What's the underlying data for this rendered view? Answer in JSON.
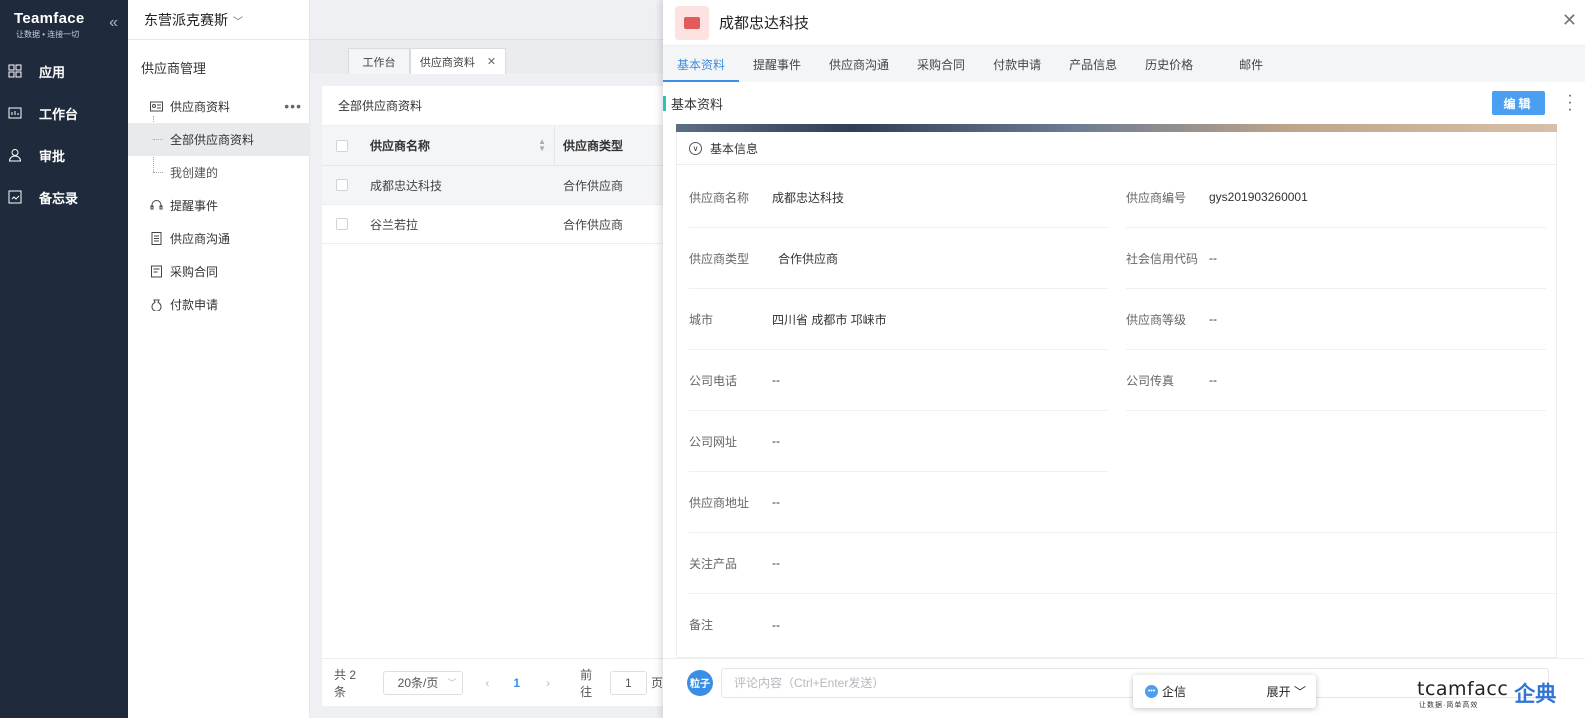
{
  "app": {
    "brand": "Teamface",
    "tagline": "让数据 • 连接一切",
    "nav": [
      {
        "label": "应用",
        "icon": "grid-icon"
      },
      {
        "label": "工作台",
        "icon": "dashboard-icon"
      },
      {
        "label": "审批",
        "icon": "user-approval-icon"
      },
      {
        "label": "备忘录",
        "icon": "memo-icon"
      }
    ]
  },
  "module": {
    "company": "东营派克赛斯",
    "title": "供应商管理",
    "menu": {
      "profile": "供应商资料",
      "all": "全部供应商资料",
      "mine": "我创建的",
      "reminder": "提醒事件",
      "communication": "供应商沟通",
      "contract": "采购合同",
      "payment": "付款申请"
    }
  },
  "tabs": {
    "workbench": "工作台",
    "supplier": "供应商资料"
  },
  "list": {
    "title": "全部供应商资料",
    "columns": [
      "供应商名称",
      "供应商类型"
    ],
    "rows": [
      {
        "name": "成都忠达科技",
        "type": "合作供应商"
      },
      {
        "name": "谷兰若拉",
        "type": "合作供应商"
      }
    ],
    "pager": {
      "total": "共 2 条",
      "size": "20条/页",
      "current": "1",
      "goto_label": "前往",
      "goto_value": "1",
      "page_suffix": "页"
    }
  },
  "detail": {
    "title": "成都忠达科技",
    "tabs": [
      "基本资料",
      "提醒事件",
      "供应商沟通",
      "采购合同",
      "付款申请",
      "产品信息",
      "历史价格",
      "邮件"
    ],
    "section": "基本资料",
    "edit": "编辑",
    "group": "基本信息",
    "fields_left": [
      {
        "label": "供应商名称",
        "value": "成都忠达科技"
      },
      {
        "label": "供应商类型",
        "value": "合作供应商"
      },
      {
        "label": "城市",
        "value": "四川省 成都市 邛崃市"
      },
      {
        "label": "公司电话",
        "value": "--"
      },
      {
        "label": "公司网址",
        "value": "--"
      },
      {
        "label": "供应商地址",
        "value": "--"
      },
      {
        "label": "关注产品",
        "value": "--"
      },
      {
        "label": "备注",
        "value": "--"
      }
    ],
    "fields_right": [
      {
        "label": "供应商编号",
        "value": "gys201903260001"
      },
      {
        "label": "社会信用代码",
        "value": "--"
      },
      {
        "label": "供应商等级",
        "value": "--"
      },
      {
        "label": "公司传真",
        "value": "--"
      }
    ],
    "comment": {
      "avatar": "粒子",
      "placeholder": "评论内容（Ctrl+Enter发送）"
    }
  },
  "chat": {
    "label": "企信",
    "expand": "展开"
  },
  "watermark": {
    "en": "tcamfacc",
    "sub": "让数据·简单高效",
    "cn": "企典"
  }
}
